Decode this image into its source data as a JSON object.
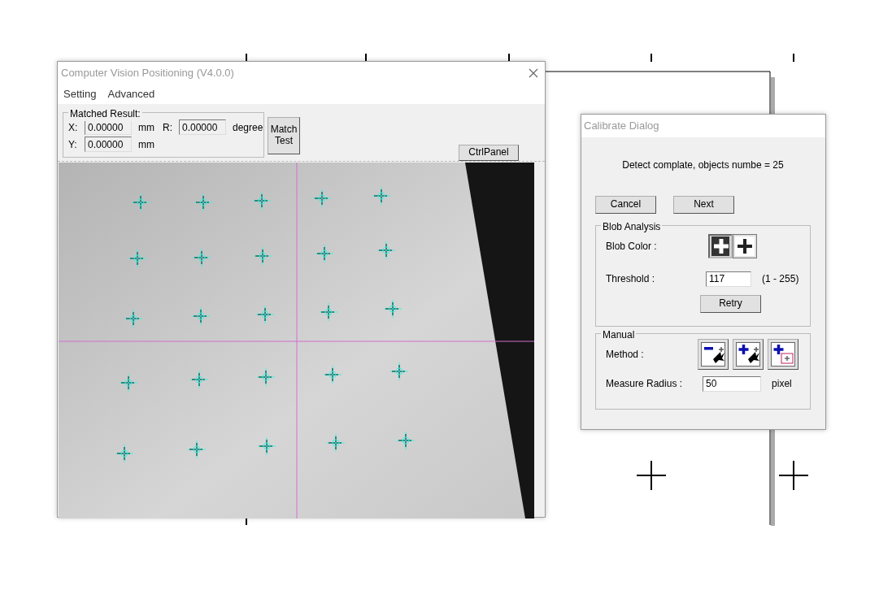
{
  "main_window": {
    "title": "Computer Vision Positioning (V4.0.0)",
    "menu": [
      {
        "label": "Setting"
      },
      {
        "label": "Advanced"
      }
    ],
    "matched_result": {
      "legend": "Matched Result:",
      "fields": [
        {
          "label": "X:",
          "value": "0.00000",
          "unit": "mm"
        },
        {
          "label": "R:",
          "value": "0.00000",
          "unit": "degree"
        },
        {
          "label": "Y:",
          "value": "0.00000",
          "unit": "mm"
        }
      ]
    },
    "match_button": "Match Test",
    "ctrl_button": "CtrlPanel"
  },
  "calibrate_dialog": {
    "title": "Calibrate Dialog",
    "message": "Detect complate, objects numbe = 25",
    "buttons": [
      "Cancel",
      "Next"
    ],
    "blob_analysis": {
      "legend": "Blob Analysis",
      "blob_color_label": "Blob Color :",
      "blob_colors": [
        {
          "kind": "dark",
          "selected": true
        },
        {
          "kind": "light",
          "selected": false
        }
      ],
      "threshold_label": "Threshold :",
      "threshold": "117",
      "range": "(1 - 255)",
      "retry": "Retry"
    },
    "manual": {
      "legend": "Manual",
      "method_label": "Method :",
      "methods": [
        {
          "kind": "remove"
        },
        {
          "kind": "add"
        },
        {
          "kind": "add-box"
        }
      ],
      "radius_label": "Measure Radius :",
      "radius": "50",
      "unit": "pixel"
    }
  }
}
